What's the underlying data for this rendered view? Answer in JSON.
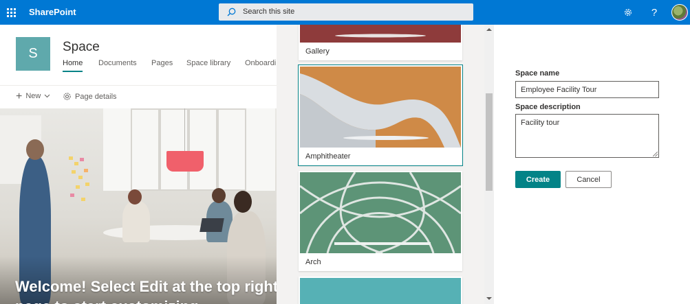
{
  "suite_bar": {
    "brand": "SharePoint",
    "search_placeholder": "Search this site",
    "icons": [
      "app-launcher-icon",
      "search-icon",
      "settings-icon",
      "help-icon"
    ],
    "accent": "#0078d4"
  },
  "site": {
    "logo_letter": "S",
    "title": "Space",
    "logo_color": "#5fa9ac",
    "nav": [
      {
        "label": "Home",
        "active": true
      },
      {
        "label": "Documents",
        "active": false
      },
      {
        "label": "Pages",
        "active": false
      },
      {
        "label": "Space library",
        "active": false
      },
      {
        "label": "Onboardi",
        "active": false
      }
    ]
  },
  "command_bar": {
    "new_label": "New",
    "page_details_label": "Page details"
  },
  "hero": {
    "welcome_line1": "Welcome! Select Edit at the top right c",
    "welcome_line2": "page to start customizing"
  },
  "templates": [
    {
      "label": "Gallery",
      "selected": false
    },
    {
      "label": "Amphitheater",
      "selected": true
    },
    {
      "label": "Arch",
      "selected": false
    }
  ],
  "form": {
    "name_label": "Space name",
    "name_value": "Employee Facility Tour",
    "description_label": "Space description",
    "description_value": "Facility tour",
    "create_label": "Create",
    "cancel_label": "Cancel",
    "primary_color": "#038387"
  }
}
